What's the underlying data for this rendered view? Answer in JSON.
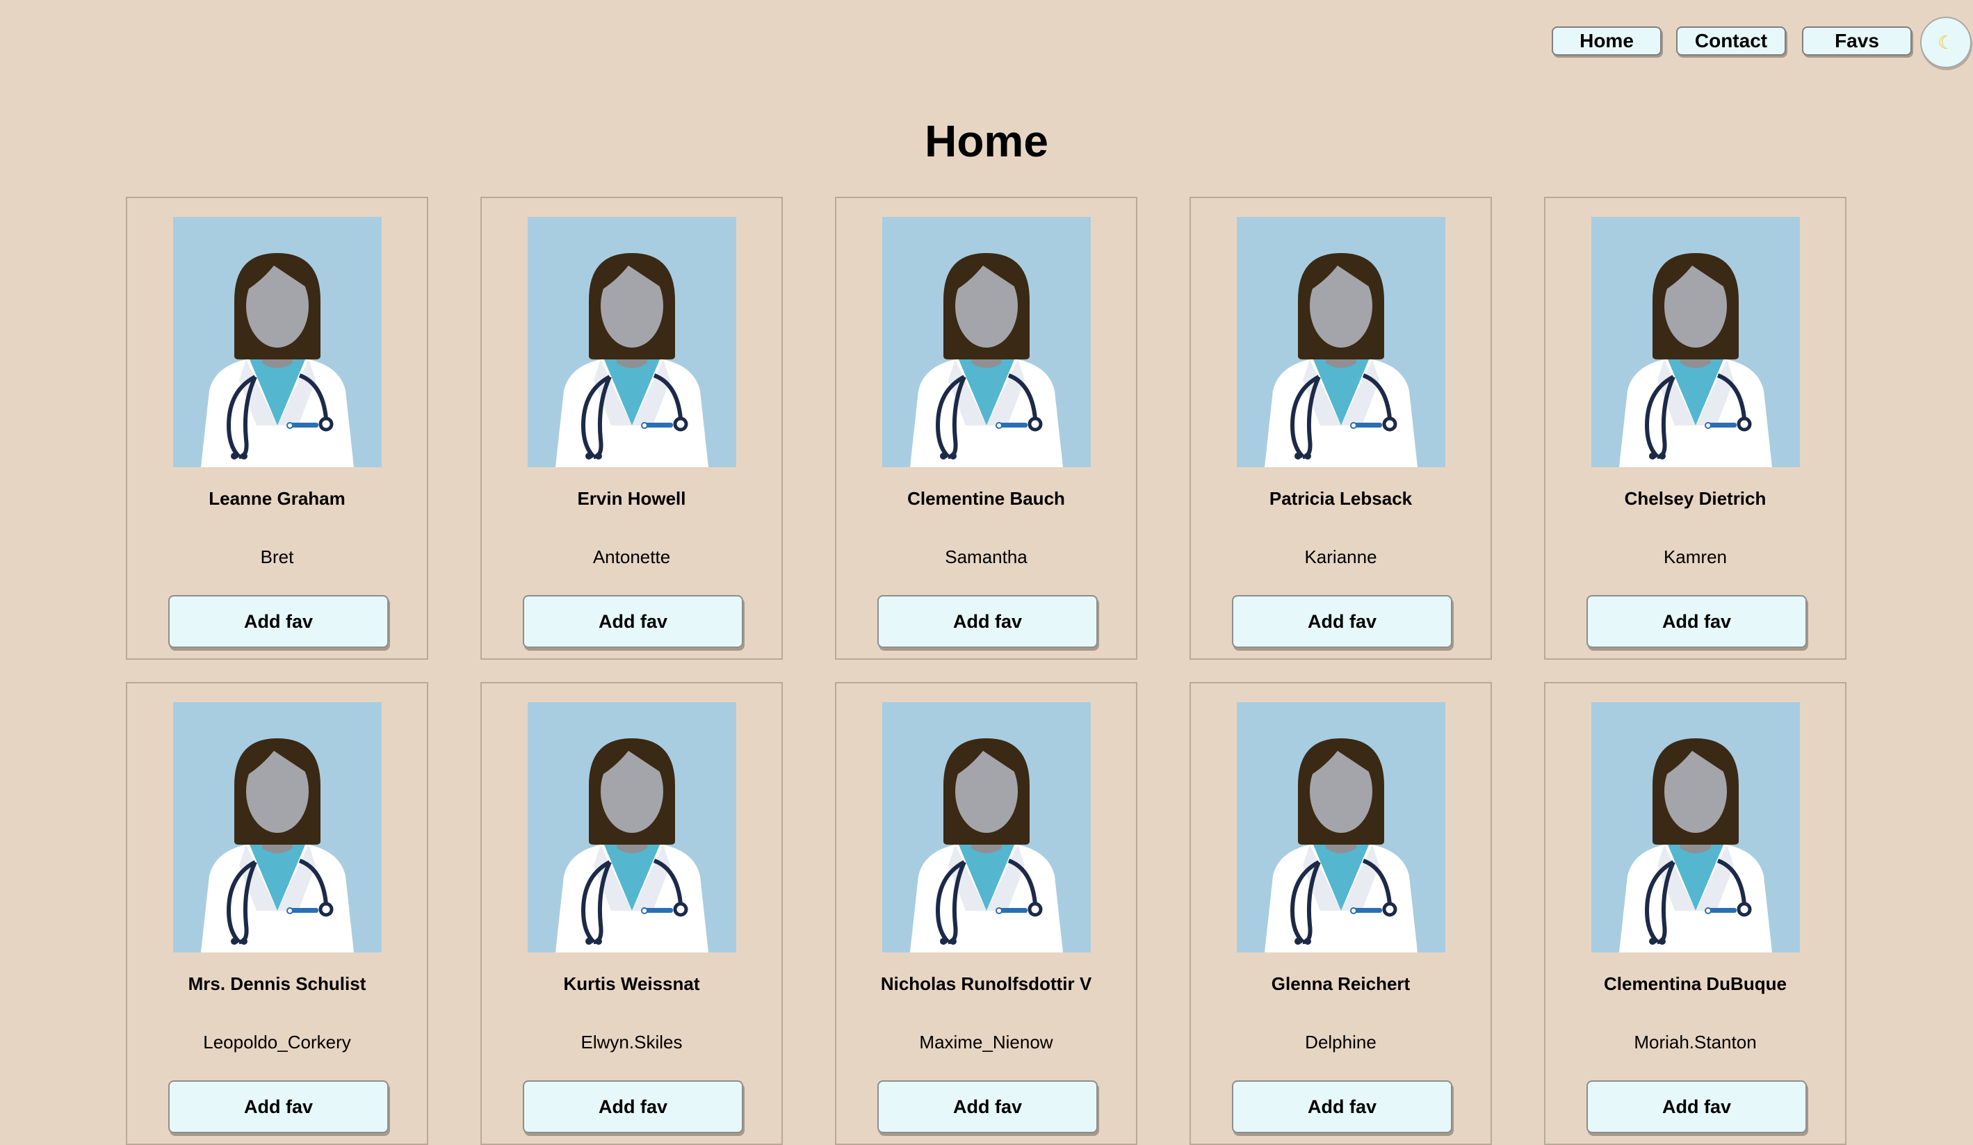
{
  "nav": {
    "home_label": "Home",
    "contact_label": "Contact",
    "favs_label": "Favs",
    "theme_icon": "moon-icon"
  },
  "page": {
    "title": "Home"
  },
  "cards": [
    {
      "name": "Leanne Graham",
      "username": "Bret",
      "button_label": "Add fav"
    },
    {
      "name": "Ervin Howell",
      "username": "Antonette",
      "button_label": "Add fav"
    },
    {
      "name": "Clementine Bauch",
      "username": "Samantha",
      "button_label": "Add fav"
    },
    {
      "name": "Patricia Lebsack",
      "username": "Karianne",
      "button_label": "Add fav"
    },
    {
      "name": "Chelsey Dietrich",
      "username": "Kamren",
      "button_label": "Add fav"
    },
    {
      "name": "Mrs. Dennis Schulist",
      "username": "Leopoldo_Corkery",
      "button_label": "Add fav"
    },
    {
      "name": "Kurtis Weissnat",
      "username": "Elwyn.Skiles",
      "button_label": "Add fav"
    },
    {
      "name": "Nicholas Runolfsdottir V",
      "username": "Maxime_Nienow",
      "button_label": "Add fav"
    },
    {
      "name": "Glenna Reichert",
      "username": "Delphine",
      "button_label": "Add fav"
    },
    {
      "name": "Clementina DuBuque",
      "username": "Moriah.Stanton",
      "button_label": "Add fav"
    }
  ],
  "colors": {
    "background": "#e7d5c3",
    "button_bg": "#e6f8fa",
    "avatar_bg": "#a9cde0"
  }
}
